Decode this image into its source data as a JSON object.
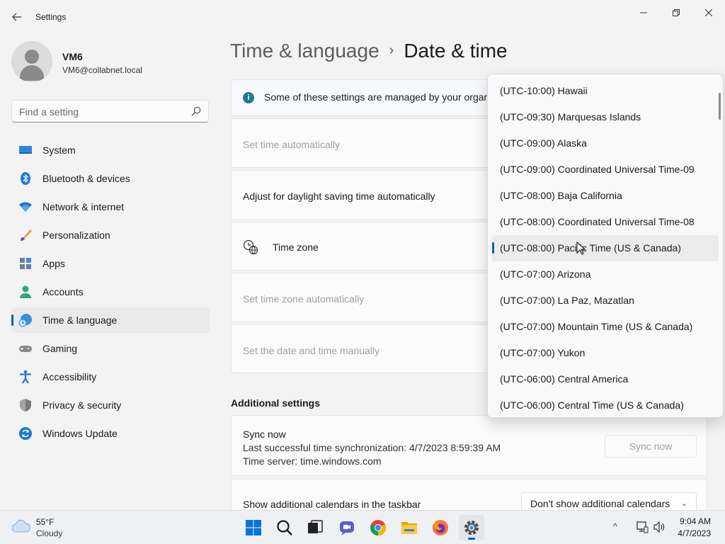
{
  "window": {
    "title": "Settings",
    "back_icon": "back-arrow-icon",
    "minimize_icon": "minimize-icon",
    "maximize_icon": "restore-icon",
    "close_icon": "close-icon"
  },
  "profile": {
    "name": "VM6",
    "email": "VM6@collabnet.local"
  },
  "search": {
    "placeholder": "Find a setting"
  },
  "sidebar": {
    "items": [
      {
        "label": "System",
        "icon": "system-icon"
      },
      {
        "label": "Bluetooth & devices",
        "icon": "bluetooth-icon"
      },
      {
        "label": "Network & internet",
        "icon": "network-icon"
      },
      {
        "label": "Personalization",
        "icon": "brush-icon"
      },
      {
        "label": "Apps",
        "icon": "apps-icon"
      },
      {
        "label": "Accounts",
        "icon": "accounts-icon"
      },
      {
        "label": "Time & language",
        "icon": "time-language-icon",
        "active": true
      },
      {
        "label": "Gaming",
        "icon": "gaming-icon"
      },
      {
        "label": "Accessibility",
        "icon": "accessibility-icon"
      },
      {
        "label": "Privacy & security",
        "icon": "shield-icon"
      },
      {
        "label": "Windows Update",
        "icon": "update-icon"
      }
    ]
  },
  "breadcrumb": {
    "parent": "Time & language",
    "separator": "›",
    "current": "Date & time"
  },
  "main": {
    "info_banner": "Some of these settings are managed by your organi",
    "set_time_auto": "Set time automatically",
    "daylight_saving": "Adjust for daylight saving time automatically",
    "time_zone": "Time zone",
    "set_timezone_auto": "Set time zone automatically",
    "set_manually": "Set the date and time manually",
    "additional_settings": "Additional settings",
    "sync": {
      "title": "Sync now",
      "last_sync": "Last successful time synchronization: 4/7/2023 8:59:39 AM",
      "server": "Time server: time.windows.com",
      "button": "Sync now"
    },
    "calendars": {
      "label": "Show additional calendars in the taskbar",
      "value": "Don't show additional calendars"
    }
  },
  "timezone_dropdown": {
    "items": [
      "(UTC-10:00) Hawaii",
      "(UTC-09:30) Marquesas Islands",
      "(UTC-09:00) Alaska",
      "(UTC-09:00) Coordinated Universal Time-09",
      "(UTC-08:00) Baja California",
      "(UTC-08:00) Coordinated Universal Time-08",
      "(UTC-08:00) Pacific Time (US & Canada)",
      "(UTC-07:00) Arizona",
      "(UTC-07:00) La Paz, Mazatlan",
      "(UTC-07:00) Mountain Time (US & Canada)",
      "(UTC-07:00) Yukon",
      "(UTC-06:00) Central America",
      "(UTC-06:00) Central Time (US & Canada)"
    ],
    "selected_index": 6
  },
  "taskbar": {
    "weather": {
      "temp": "55°F",
      "condition": "Cloudy",
      "icon": "cloud-icon"
    },
    "apps": [
      {
        "name": "start-icon"
      },
      {
        "name": "search-icon"
      },
      {
        "name": "task-view-icon"
      },
      {
        "name": "teams-chat-icon"
      },
      {
        "name": "chrome-icon"
      },
      {
        "name": "file-explorer-icon"
      },
      {
        "name": "firefox-icon"
      },
      {
        "name": "settings-gear-icon",
        "active": true
      }
    ],
    "tray": {
      "chevron": "^",
      "time": "9:04 AM",
      "date": "4/7/2023"
    }
  },
  "colors": {
    "accent": "#005fb8",
    "background": "#f3f3f3",
    "card": "#fbfbfb"
  }
}
